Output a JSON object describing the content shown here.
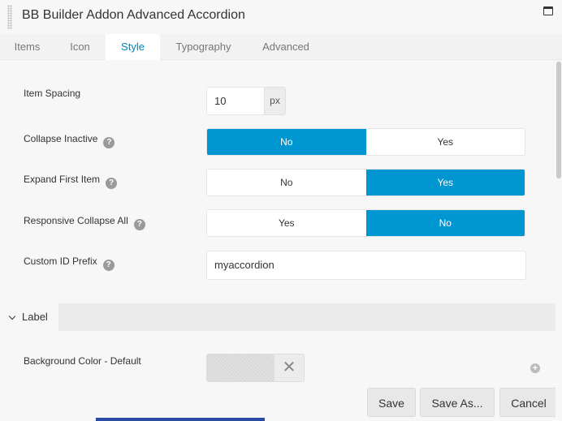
{
  "window": {
    "title": "BB Builder Addon Advanced Accordion"
  },
  "tabs": [
    {
      "label": "Items",
      "active": false
    },
    {
      "label": "Icon",
      "active": false
    },
    {
      "label": "Style",
      "active": true
    },
    {
      "label": "Typography",
      "active": false
    },
    {
      "label": "Advanced",
      "active": false
    }
  ],
  "fields": {
    "item_spacing": {
      "label": "Item Spacing",
      "value": "10",
      "unit": "px"
    },
    "collapse_inactive": {
      "label": "Collapse Inactive",
      "options": [
        "No",
        "Yes"
      ],
      "selected": "No"
    },
    "expand_first": {
      "label": "Expand First Item",
      "options": [
        "No",
        "Yes"
      ],
      "selected": "Yes"
    },
    "responsive_collapse": {
      "label": "Responsive Collapse All",
      "options": [
        "Yes",
        "No"
      ],
      "selected": "No"
    },
    "custom_id_prefix": {
      "label": "Custom ID Prefix",
      "value": "myaccordion"
    }
  },
  "section": {
    "label": "Label"
  },
  "label_section": {
    "bg_color": {
      "label": "Background Color - Default",
      "clear_symbol": "✕"
    }
  },
  "footer": {
    "save": "Save",
    "save_as": "Save As...",
    "cancel": "Cancel"
  },
  "colors": {
    "accent": "#0096d1",
    "active_tab_text": "#0086b6"
  },
  "icons": {
    "help": "?",
    "add": "+"
  }
}
